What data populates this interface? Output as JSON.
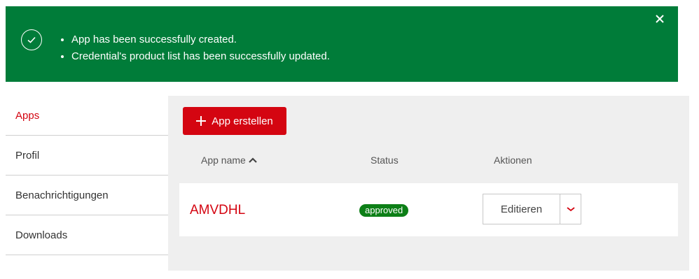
{
  "alert": {
    "messages": [
      "App has been successfully created.",
      "Credential's product list has been successfully updated."
    ],
    "icon": "check-circle-icon",
    "close_icon": "close-icon",
    "color": "#007c39"
  },
  "sidebar": {
    "items": [
      {
        "label": "Apps",
        "active": true
      },
      {
        "label": "Profil",
        "active": false
      },
      {
        "label": "Benachrichtigungen",
        "active": false
      },
      {
        "label": "Downloads",
        "active": false
      }
    ]
  },
  "main": {
    "create_button": "App erstellen",
    "columns": [
      "App name",
      "Status",
      "Aktionen"
    ],
    "rows": [
      {
        "app_name": "AMVDHL",
        "status": "approved",
        "action": "Editieren"
      }
    ]
  },
  "colors": {
    "brand_red": "#d40511",
    "status_green": "#0d7f17"
  }
}
